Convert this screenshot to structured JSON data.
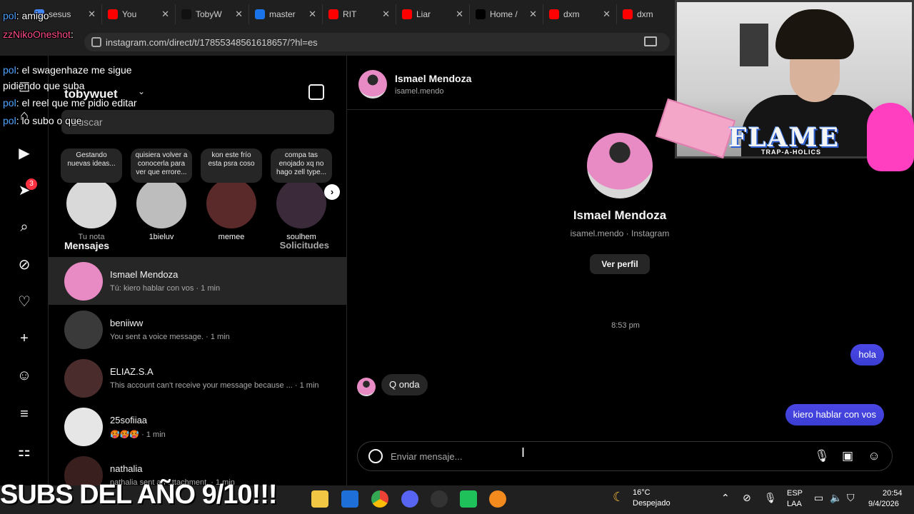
{
  "browser": {
    "tabs": [
      {
        "title": "sesus",
        "color": "#4285f4"
      },
      {
        "title": "You",
        "color": "#ff0000"
      },
      {
        "title": "TobyW",
        "color": "#111111"
      },
      {
        "title": "master",
        "color": "#1a73e8"
      },
      {
        "title": "RIT",
        "color": "#ff0000"
      },
      {
        "title": "Liar",
        "color": "#ff0000"
      },
      {
        "title": "Home /",
        "color": "#000000"
      },
      {
        "title": "dxm",
        "color": "#ff0000"
      },
      {
        "title": "dxm",
        "color": "#ff0000"
      }
    ],
    "url": "instagram.com/direct/t/17855348561618657/?hl=es"
  },
  "stream_chat": [
    {
      "user": "pol",
      "text": ": amigo"
    },
    {
      "user": "zzNikoOneshot",
      "text": ":"
    },
    {
      "user": "pol",
      "text": ": el swagenhaze me sigue"
    },
    {
      "user": "",
      "text": "pidiendo que suba"
    },
    {
      "user": "pol",
      "text": ": el reel que me pidio editar"
    },
    {
      "user": "pol",
      "text": ": lo subo o que"
    }
  ],
  "nav": {
    "badge_count": "3",
    "icons": [
      "instagram-icon",
      "home-icon",
      "reels-icon",
      "messages-icon",
      "search-icon",
      "explore-icon",
      "notifications-icon",
      "create-icon",
      "profile-icon",
      "menu-icon",
      "more-apps-icon"
    ]
  },
  "list": {
    "account": "tobywuet",
    "search_placeholder": "Buscar",
    "notes": [
      {
        "bubble": "Gestando nuevas ideas...",
        "name": "Tu nota",
        "muted": true,
        "color": "#d9d9d9"
      },
      {
        "bubble": "quisiera volver a conocerla para ver que errore...",
        "name": "1bieluv",
        "muted": false,
        "color": "#bdbdbd"
      },
      {
        "bubble": "kon este frío esta psra coso",
        "name": "memee",
        "muted": false,
        "color": "#5a2a2a"
      },
      {
        "bubble": "compa tas enojado xq no hago zell type...",
        "name": "soulhem",
        "muted": false,
        "color": "#3a2a3a"
      }
    ],
    "messages_label": "Mensajes",
    "requests_label": "Solicitudes",
    "conversations": [
      {
        "name": "Ismael Mendoza",
        "preview": "Tú: kiero hablar con vos · 1 min",
        "color": "#e88ac4"
      },
      {
        "name": "beniiww",
        "preview": "You sent a voice message. · 1 min",
        "color": "#3a3a3a"
      },
      {
        "name": "ELIAZ.S.A",
        "preview": "This account can't receive your message because ... · 1 min",
        "color": "#4a2c2c"
      },
      {
        "name": "25sofiiaa",
        "preview": "🥵🥵🥵 · 1 min",
        "color": "#e6e6e6"
      },
      {
        "name": "nathalia",
        "preview": "nathalia sent an attachment. · 1 min",
        "color": "#3a1f1f"
      }
    ]
  },
  "chat": {
    "name": "Ismael Mendoza",
    "username": "isamel.mendo",
    "profile_sub": "isamel.mendo · Instagram",
    "view_profile": "Ver perfil",
    "timestamp": "8:53 pm",
    "messages": [
      {
        "dir": "out",
        "text": "hola"
      },
      {
        "dir": "in",
        "text": "Q onda"
      },
      {
        "dir": "out",
        "text": "kiero hablar con vos"
      }
    ],
    "composer_placeholder": "Enviar mensaje..."
  },
  "overlay": {
    "logo": "FLAME",
    "logo_sub": "TRAP-A-HOLICS",
    "banner": "SUBS DEL AÑO 9/10!!!"
  },
  "taskbar": {
    "weather_temp": "16°C",
    "weather_cond": "Despejado",
    "lang1": "ESP",
    "lang2": "LAA",
    "time": "20:54",
    "date": "9/4/2026"
  }
}
